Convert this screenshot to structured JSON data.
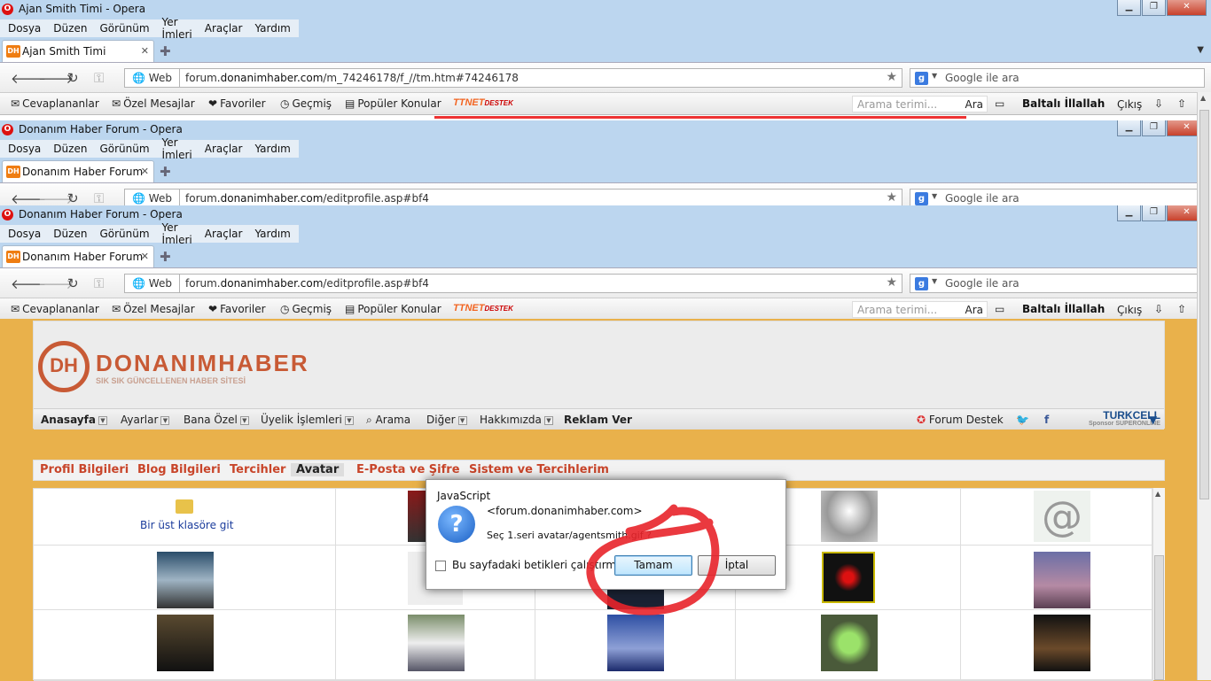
{
  "windows": [
    {
      "title": "Ajan Smith Timi - Opera",
      "tab_title": "Ajan Smith Timi",
      "address_web": "Web",
      "address_host": "forum.",
      "address_domain": "donanimhaber.com",
      "address_path": "/m_74246178/f_//tm.htm#74246178",
      "search_placeholder": "Google ile ara"
    },
    {
      "title": "Donanım Haber Forum - Opera",
      "tab_title": "Donanım Haber Forum",
      "address_web": "Web",
      "address_host": "forum.",
      "address_domain": "donanimhaber.com",
      "address_path": "/editprofile.asp#bf4",
      "search_placeholder": "Google ile ara"
    },
    {
      "title": "Donanım Haber Forum - Opera",
      "tab_title": "Donanım Haber Forum",
      "address_web": "Web",
      "address_host": "forum.",
      "address_domain": "donanimhaber.com",
      "address_path": "/editprofile.asp#bf4",
      "search_placeholder": "Google ile ara"
    }
  ],
  "menu": [
    "Dosya",
    "Düzen",
    "Görünüm",
    "Yer İmleri",
    "Araçlar",
    "Yardım"
  ],
  "favicon_text": "DH",
  "bookmarks": {
    "items": [
      "Cevaplananlar",
      "Özel Mesajlar",
      "Favoriler",
      "Geçmiş",
      "Popüler Konular"
    ],
    "ttnet": "TTNET",
    "ttnet_sub": "DESTEK",
    "search_placeholder": "Arama terimi...",
    "search_button": "Ara",
    "user": "Baltalı İllallah",
    "logout": "Çıkış"
  },
  "site": {
    "logo_letters": "DH",
    "logo_name": "DONANIMHABER",
    "logo_tagline": "SIK SIK GÜNCELLENEN HABER SİTESİ",
    "nav": [
      "Anasayfa",
      "Ayarlar",
      "Bana Özel",
      "Üyelik İşlemleri",
      "Arama",
      "Diğer",
      "Hakkımızda",
      "Reklam Ver"
    ],
    "forum_destek": "Forum Destek",
    "sponsor_name": "TURKCELL",
    "sponsor_sub": "Sponsor SUPERONLINE",
    "profile_tabs": [
      "Profil Bilgileri",
      "Blog Bilgileri",
      "Tercihler",
      "Avatar",
      "E-Posta ve Şifre",
      "Sistem ve Tercihlerim"
    ],
    "active_tab": "Avatar",
    "up_folder": "Bir üst klasöre git"
  },
  "dialog": {
    "title": "JavaScript",
    "host": "<forum.donanimhaber.com>",
    "message": "Seç 1.seri avatar/agentsmith.gif ?",
    "checkbox_label": "Bu sayfadaki betikleri çalıştırma",
    "ok": "Tamam",
    "cancel": "İptal"
  },
  "colors": {
    "page_bg": "#e9b14b",
    "brand_orange": "#c8452a",
    "titlebar_bg": "#bcd6ef",
    "annotation_red": "#e8232a"
  }
}
